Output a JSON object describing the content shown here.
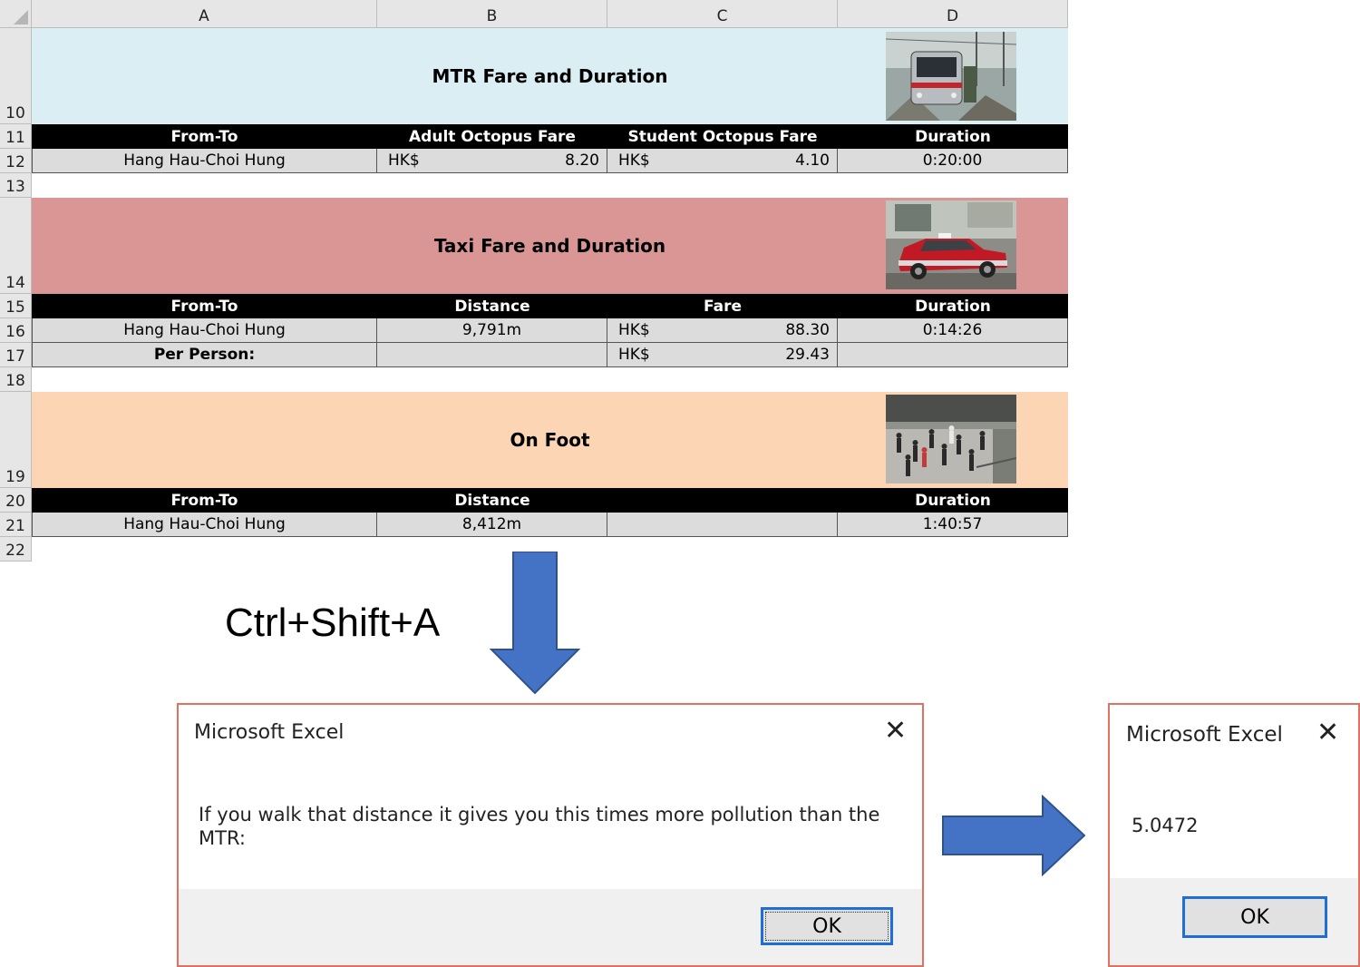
{
  "sheet": {
    "columns": [
      "A",
      "B",
      "C",
      "D"
    ],
    "rows": [
      "10",
      "11",
      "12",
      "13",
      "14",
      "15",
      "16",
      "17",
      "18",
      "19",
      "20",
      "21",
      "22"
    ],
    "mtr": {
      "title": "MTR Fare and Duration",
      "headers": [
        "From-To",
        "Adult Octopus Fare",
        "Student Octopus Fare",
        "Duration"
      ],
      "route": "Hang Hau-Choi Hung",
      "adult_currency": "HK$",
      "adult_fare": "8.20",
      "student_currency": "HK$",
      "student_fare": "4.10",
      "duration": "0:20:00"
    },
    "taxi": {
      "title": "Taxi Fare and Duration",
      "headers": [
        "From-To",
        "Distance",
        "Fare",
        "Duration"
      ],
      "route": "Hang Hau-Choi Hung",
      "distance": "9,791m",
      "currency": "HK$",
      "fare": "88.30",
      "duration": "0:14:26",
      "per_person_label": "Per Person:",
      "per_person_currency": "HK$",
      "per_person_fare": "29.43"
    },
    "foot": {
      "title": "On Foot",
      "headers": [
        "From-To",
        "Distance",
        "",
        "Duration"
      ],
      "route": "Hang Hau-Choi Hung",
      "distance": "8,412m",
      "duration": "1:40:57"
    }
  },
  "shortcut": "Ctrl+Shift+A",
  "dialog1": {
    "title": "Microsoft Excel",
    "message_line1": "If you walk that distance it gives you this times more pollution than the",
    "message_line2": "MTR:",
    "ok_label": "OK"
  },
  "dialog2": {
    "title": "Microsoft Excel",
    "value": "5.0472",
    "ok_label": "OK"
  },
  "colors": {
    "mtr_banner": "#daeef3",
    "taxi_banner": "#da9694",
    "foot_banner": "#fcd5b4",
    "arrow": "#4472c4",
    "dialog_border": "#e07060"
  },
  "icons": [
    "close-icon",
    "down-arrow-icon",
    "right-arrow-icon"
  ]
}
